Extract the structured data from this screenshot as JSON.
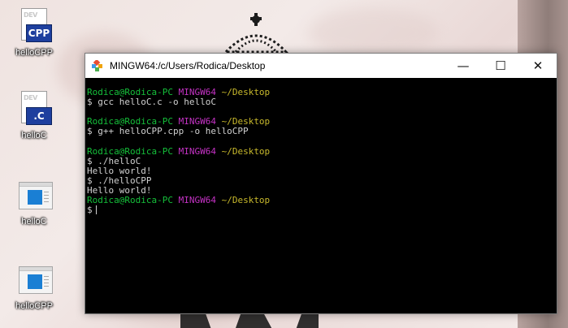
{
  "desktop": {
    "icons": [
      {
        "label": "helloCPP",
        "badge": "CPP",
        "stamp": "DEV"
      },
      {
        "label": "helloC",
        "badge": ".C",
        "stamp": "DEV"
      },
      {
        "label": "helloC"
      },
      {
        "label": "helloCPP"
      }
    ]
  },
  "window": {
    "title": "MINGW64:/c/Users/Rodica/Desktop",
    "controls": {
      "minimize": "—",
      "maximize": "☐",
      "close": "✕"
    }
  },
  "terminal": {
    "prompt": {
      "user": "Rodica@Rodica-PC",
      "shell": "MINGW64",
      "path": "~/Desktop"
    },
    "lines": [
      "$ gcc helloC.c -o helloC",
      "$ g++ helloCPP.cpp -o helloCPP",
      "$ ./helloC",
      "Hello world!",
      "$ ./helloCPP",
      "Hello world!",
      "$"
    ]
  },
  "colors": {
    "user": "#15c03a",
    "shell": "#c432c4",
    "path": "#c8b92c",
    "text": "#d0d0d0",
    "badge": "#1e3f9e"
  }
}
